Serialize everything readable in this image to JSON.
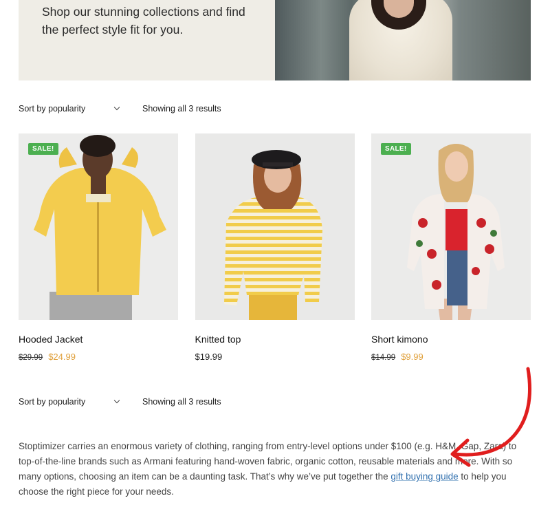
{
  "hero": {
    "text": "Shop our stunning collections and find the perfect style fit for you."
  },
  "toolbar_top": {
    "sort_label": "Sort by popularity",
    "results_text": "Showing all 3 results"
  },
  "toolbar_bottom": {
    "sort_label": "Sort by popularity",
    "results_text": "Showing all 3 results"
  },
  "products": [
    {
      "name": "Hooded Jacket",
      "badge": "SALE!",
      "old_price": "$29.99",
      "price": "$24.99"
    },
    {
      "name": "Knitted top",
      "badge": "",
      "old_price": "",
      "price": "$19.99"
    },
    {
      "name": "Short kimono",
      "badge": "SALE!",
      "old_price": "$14.99",
      "price": "$9.99"
    }
  ],
  "description": {
    "before_link": "Stoptimizer carries an enormous variety of clothing, ranging from entry-level options under $100 (e.g. H&M, Gap, Zara) to top-of-the-line brands such as Armani featuring hand-woven fabric, organic cotton, reusable materials and more. With so many options, choosing an item can be a daunting task. That’s why we’ve put together the ",
    "link_text": "gift buying guide",
    "after_link": " to help you choose the right piece for your needs."
  },
  "colors": {
    "sale_badge": "#4caf50",
    "sale_price": "#e0a03b",
    "link": "#2f6fae",
    "annotation_arrow": "#e01e1e",
    "hero_panel": "#efede6"
  }
}
